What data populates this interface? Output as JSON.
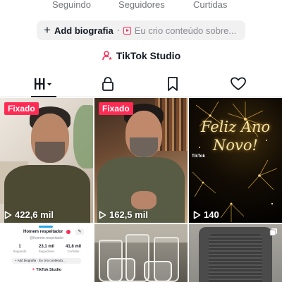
{
  "profile_stats": {
    "following_label": "Seguindo",
    "followers_label": "Seguidores",
    "likes_label": "Curtidas"
  },
  "bio": {
    "add_label": "Add biografia",
    "promo_text": "Eu crio conteúdo sobre..."
  },
  "studio": {
    "label": "TikTok Studio"
  },
  "tabs": [
    {
      "name": "videos",
      "icon": "grid-icon"
    },
    {
      "name": "private",
      "icon": "lock-icon"
    },
    {
      "name": "favorites",
      "icon": "bookmark-icon"
    },
    {
      "name": "liked",
      "icon": "heart-icon"
    }
  ],
  "videos": [
    {
      "pinned": "Fixado",
      "views": "422,6 mil"
    },
    {
      "pinned": "Fixado",
      "views": "162,5 mil"
    },
    {
      "overlay_text": "Feliz Ano Novo!",
      "watermark": "TikTok",
      "views": "140"
    }
  ],
  "mini_profile": {
    "name": "Homem respeitador",
    "handle": "@homem.respeitador",
    "stats": [
      {
        "value": "1",
        "label": "Seguindo"
      },
      {
        "value": "23,1 mil",
        "label": "Seguidores"
      },
      {
        "value": "41,8 mil",
        "label": "Curtidas"
      }
    ],
    "bio_add": "Add biografia",
    "bio_promo": "Eu crio conteúdo...",
    "studio": "TikTok Studio"
  },
  "colors": {
    "accent": "#fe2c55",
    "text": "#161823",
    "muted": "#73757b",
    "pill_bg": "#f1f1f2"
  }
}
